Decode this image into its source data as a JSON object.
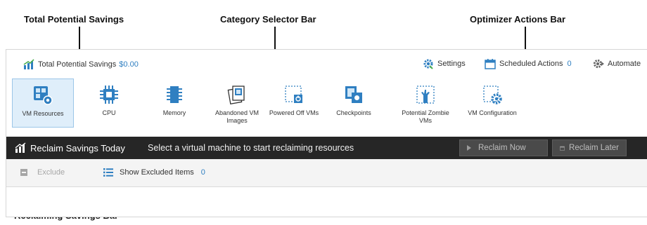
{
  "callouts": {
    "total_potential_savings": "Total Potential Savings",
    "category_selector_bar": "Category Selector Bar",
    "optimizer_actions_bar": "Optimizer Actions Bar",
    "reclaiming_savings_bar": "Reclaiming Savings Bar"
  },
  "topbar": {
    "savings_label": "Total Potential Savings",
    "savings_value": "$0.00",
    "settings_label": "Settings",
    "scheduled_label": "Scheduled Actions",
    "scheduled_count": "0",
    "automate_label": "Automate"
  },
  "categories": [
    {
      "label": "VM Resources",
      "icon": "vm-resources-icon",
      "active": true
    },
    {
      "label": "CPU",
      "icon": "cpu-icon"
    },
    {
      "label": "Memory",
      "icon": "memory-icon"
    },
    {
      "label": "Abandoned VM Images",
      "icon": "abandoned-vm-images-icon"
    },
    {
      "label": "Powered Off VMs",
      "icon": "powered-off-vms-icon"
    },
    {
      "label": "Checkpoints",
      "icon": "checkpoints-icon"
    },
    {
      "label": "Potential Zombie VMs",
      "icon": "zombie-vms-icon"
    },
    {
      "label": "VM Configuration",
      "icon": "vm-configuration-icon"
    }
  ],
  "reclaim_bar": {
    "title": "Reclaim Savings Today",
    "message": "Select a virtual machine to start reclaiming resources",
    "reclaim_now": "Reclaim Now",
    "reclaim_later": "Reclaim Later"
  },
  "exclude_bar": {
    "exclude_label": "Exclude",
    "show_excluded_label": "Show Excluded Items",
    "excluded_count": "0"
  },
  "colors": {
    "accent_blue": "#2f7fc1",
    "dark_bar": "#262626",
    "active_tile": "#dfeefa"
  }
}
